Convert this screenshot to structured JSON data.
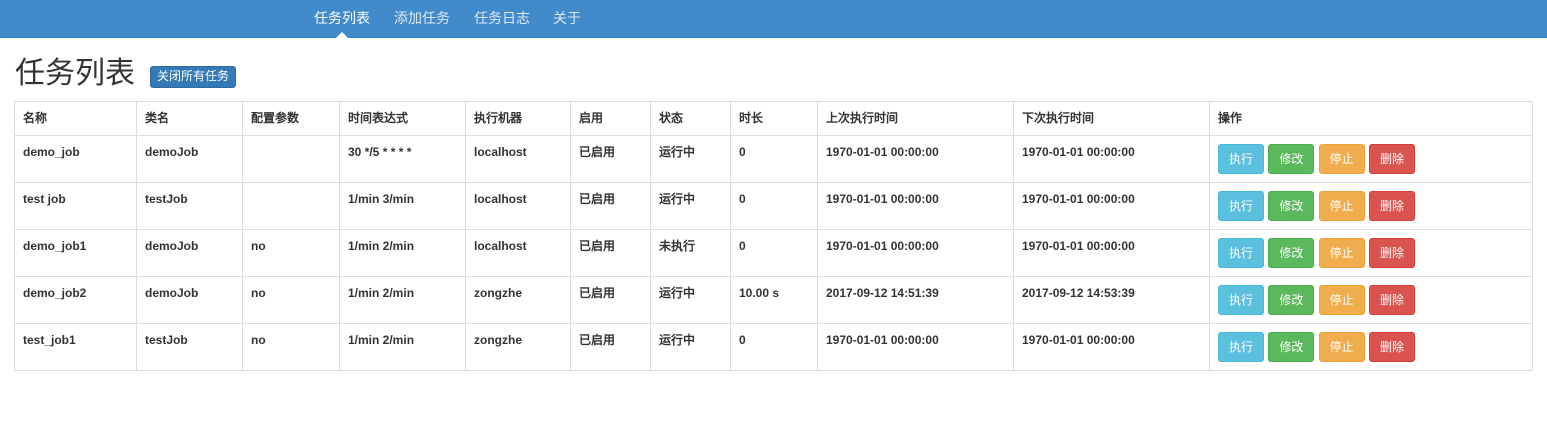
{
  "nav": {
    "items": [
      {
        "label": "任务列表",
        "active": true
      },
      {
        "label": "添加任务",
        "active": false
      },
      {
        "label": "任务日志",
        "active": false
      },
      {
        "label": "关于",
        "active": false
      }
    ]
  },
  "header": {
    "title": "任务列表",
    "close_all_label": "关闭所有任务"
  },
  "table": {
    "columns": [
      "名称",
      "类名",
      "配置参数",
      "时间表达式",
      "执行机器",
      "启用",
      "状态",
      "时长",
      "上次执行时间",
      "下次执行时间",
      "操作"
    ],
    "actions": {
      "run": "执行",
      "edit": "修改",
      "stop": "停止",
      "delete": "删除"
    },
    "rows": [
      [
        "demo_job",
        "demoJob",
        "",
        "30 */5 * * * *",
        "localhost",
        "已启用",
        "运行中",
        "0",
        "1970-01-01 00:00:00",
        "1970-01-01 00:00:00"
      ],
      [
        "test job",
        "testJob",
        "",
        "1/min 3/min",
        "localhost",
        "已启用",
        "运行中",
        "0",
        "1970-01-01 00:00:00",
        "1970-01-01 00:00:00"
      ],
      [
        "demo_job1",
        "demoJob",
        "no",
        "1/min 2/min",
        "localhost",
        "已启用",
        "未执行",
        "0",
        "1970-01-01 00:00:00",
        "1970-01-01 00:00:00"
      ],
      [
        "demo_job2",
        "demoJob",
        "no",
        "1/min 2/min",
        "zongzhe",
        "已启用",
        "运行中",
        "10.00 s",
        "2017-09-12 14:51:39",
        "2017-09-12 14:53:39"
      ],
      [
        "test_job1",
        "testJob",
        "no",
        "1/min 2/min",
        "zongzhe",
        "已启用",
        "运行中",
        "0",
        "1970-01-01 00:00:00",
        "1970-01-01 00:00:00"
      ]
    ]
  },
  "colors": {
    "navbar": "#428bca",
    "primary": "#337ab7",
    "info": "#5bc0de",
    "success": "#5cb85c",
    "warning": "#f0ad4e",
    "danger": "#d9534f"
  }
}
